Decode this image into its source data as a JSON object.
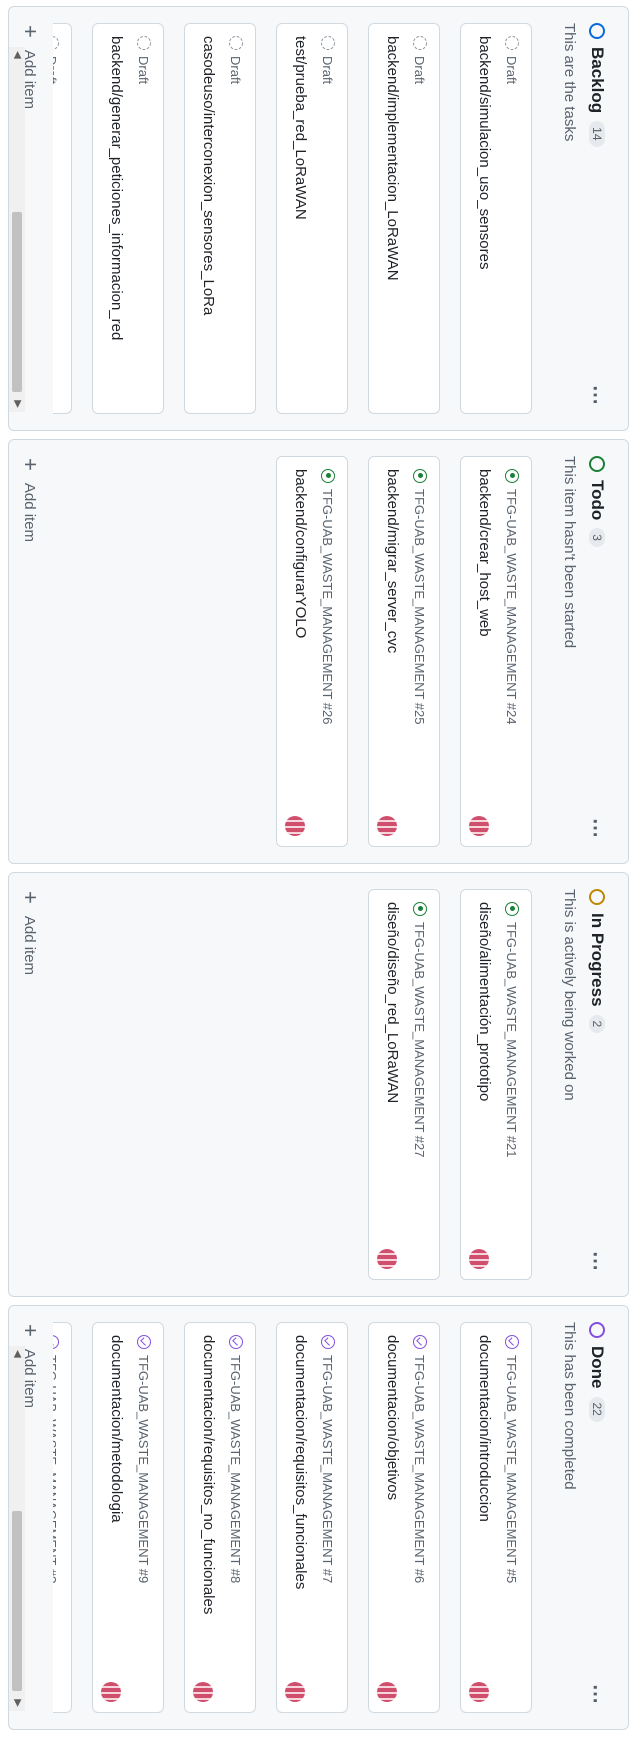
{
  "columns": [
    {
      "title": "Backlog",
      "count": "14",
      "description": "This are the tasks",
      "status_color": "#0969da",
      "cards": [
        {
          "meta": "Draft",
          "kind": "draft",
          "title": "backend/simulacion_uso_sensores"
        },
        {
          "meta": "Draft",
          "kind": "draft",
          "title": "backend/implementacion_LoRaWAN"
        },
        {
          "meta": "Draft",
          "kind": "draft",
          "title": "test/prueba_red_LoRaWAN"
        },
        {
          "meta": "Draft",
          "kind": "draft",
          "title": "casodeuso/interconexion_sensores_LoRa"
        },
        {
          "meta": "Draft",
          "kind": "draft",
          "title": "backend/generar_peticiones_informacion_red"
        },
        {
          "meta": "Draft",
          "kind": "draft",
          "title": ""
        }
      ],
      "add_label": "Add item"
    },
    {
      "title": "Todo",
      "count": "3",
      "description": "This item hasn't been started",
      "status_color": "#1a7f37",
      "cards": [
        {
          "meta": "TFG-UAB_WASTE_MANAGEMENT #24",
          "kind": "open",
          "title": "backend/crear_host_web"
        },
        {
          "meta": "TFG-UAB_WASTE_MANAGEMENT #25",
          "kind": "open",
          "title": "backend/migrar_server_cvc"
        },
        {
          "meta": "TFG-UAB_WASTE_MANAGEMENT #26",
          "kind": "open",
          "title": "backend/configurarYOLO"
        }
      ],
      "add_label": "Add item"
    },
    {
      "title": "In Progress",
      "count": "2",
      "description": "This is actively being worked on",
      "status_color": "#bf8700",
      "cards": [
        {
          "meta": "TFG-UAB_WASTE_MANAGEMENT #21",
          "kind": "open",
          "title": "diseño/alimentación_prototipo"
        },
        {
          "meta": "TFG-UAB_WASTE_MANAGEMENT #27",
          "kind": "open",
          "title": "diseño/diseño_red_LoRaWAN"
        }
      ],
      "add_label": "Add item"
    },
    {
      "title": "Done",
      "count": "22",
      "description": "This has been completed",
      "status_color": "#8250df",
      "cards": [
        {
          "meta": "TFG-UAB_WASTE_MANAGEMENT #5",
          "kind": "done",
          "title": "documentacion/introduccion"
        },
        {
          "meta": "TFG-UAB_WASTE_MANAGEMENT #6",
          "kind": "done",
          "title": "documentacion/objetivos"
        },
        {
          "meta": "TFG-UAB_WASTE_MANAGEMENT #7",
          "kind": "done",
          "title": "documentacion/requisitos_funcionales"
        },
        {
          "meta": "TFG-UAB_WASTE_MANAGEMENT #8",
          "kind": "done",
          "title": "documentacion/requisitos_no_funcionales"
        },
        {
          "meta": "TFG-UAB_WASTE_MANAGEMENT #9",
          "kind": "done",
          "title": "documentacion/metodologia"
        },
        {
          "meta": "TFG-UAB_WASTE_MANAGEMENT #?",
          "kind": "done",
          "title": ""
        }
      ],
      "add_label": "Add item"
    }
  ],
  "icons": {
    "menu": "kebab-icon",
    "add": "plus-icon",
    "draft": "dashed-circle-icon",
    "open": "issue-open-icon",
    "done": "issue-closed-icon"
  }
}
